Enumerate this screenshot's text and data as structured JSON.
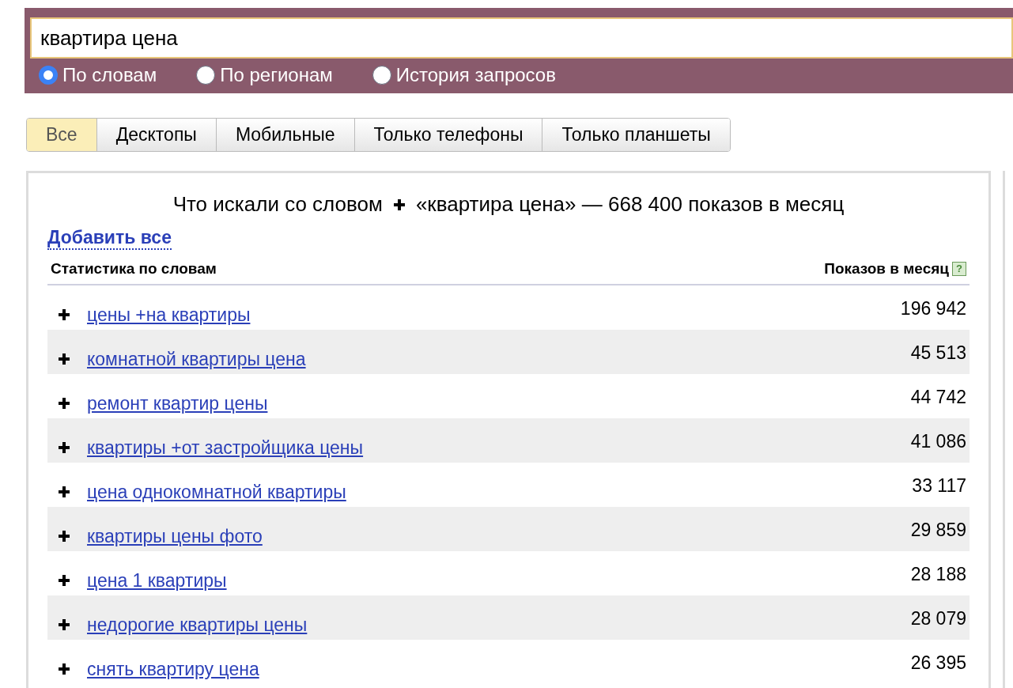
{
  "search": {
    "value": "квартира цена"
  },
  "modes": [
    {
      "label": "По словам",
      "selected": true
    },
    {
      "label": "По регионам",
      "selected": false
    },
    {
      "label": "История запросов",
      "selected": false
    }
  ],
  "tabs": [
    {
      "label": "Все",
      "selected": true
    },
    {
      "label": "Десктопы",
      "selected": false
    },
    {
      "label": "Мобильные",
      "selected": false
    },
    {
      "label": "Только телефоны",
      "selected": false
    },
    {
      "label": "Только планшеты",
      "selected": false
    }
  ],
  "panel": {
    "title_prefix": "Что искали со словом",
    "title_suffix": "«квартира цена» — 668 400 показов в месяц",
    "add_all": "Добавить все",
    "columns": [
      "Статистика по словам",
      "Показов в месяц"
    ],
    "help": "?",
    "rows": [
      {
        "phrase": "цены +на квартиры",
        "count": "196 942"
      },
      {
        "phrase": "комнатной квартиры цена",
        "count": "45 513"
      },
      {
        "phrase": "ремонт квартир цены",
        "count": "44 742"
      },
      {
        "phrase": "квартиры +от застройщика цены",
        "count": "41 086"
      },
      {
        "phrase": "цена однокомнатной квартиры",
        "count": "33 117"
      },
      {
        "phrase": "квартиры цены фото",
        "count": "29 859"
      },
      {
        "phrase": "цена 1 квартиры",
        "count": "28 188"
      },
      {
        "phrase": "недорогие квартиры цены",
        "count": "28 079"
      },
      {
        "phrase": "снять квартиру цена",
        "count": "26 395"
      }
    ]
  }
}
